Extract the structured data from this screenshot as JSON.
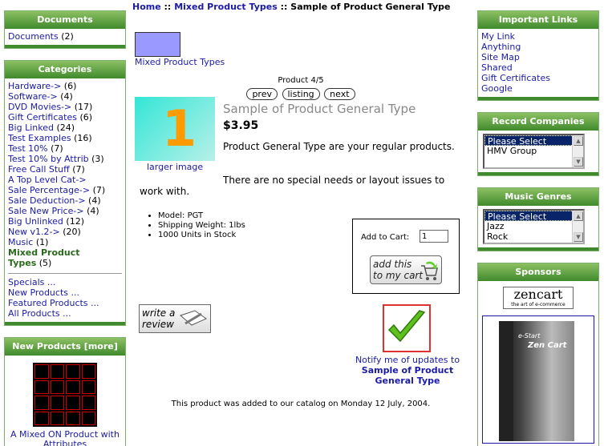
{
  "left": {
    "documents": {
      "title": "Documents",
      "item_label": "Documents",
      "item_count": "(2)"
    },
    "categories": {
      "title": "Categories",
      "items": [
        {
          "label": "Hardware->",
          "count": "(6)"
        },
        {
          "label": "Software->",
          "count": "(4)"
        },
        {
          "label": "DVD Movies->",
          "count": "(17)"
        },
        {
          "label": "Gift Certificates",
          "count": "(6)"
        },
        {
          "label": "Big Linked",
          "count": "(24)"
        },
        {
          "label": "Test Examples",
          "count": "(16)"
        },
        {
          "label": "Test 10%",
          "count": "(7)"
        },
        {
          "label": "Test 10% by Attrib",
          "count": "(3)"
        },
        {
          "label": "Free Call Stuff",
          "count": "(7)"
        },
        {
          "label": "A Top Level Cat->",
          "count": ""
        },
        {
          "label": "Sale Percentage->",
          "count": "(7)"
        },
        {
          "label": "Sale Deduction->",
          "count": "(4)"
        },
        {
          "label": "Sale New Price->",
          "count": "(4)"
        },
        {
          "label": "Big Unlinked",
          "count": "(12)"
        },
        {
          "label": "New v1.2->",
          "count": "(20)"
        },
        {
          "label": "Music",
          "count": "(1)"
        }
      ],
      "current_label_1": "Mixed Product",
      "current_label_2": "Types",
      "current_count": "(5)",
      "links": [
        "Specials ...",
        "New Products ...",
        "Featured Products ...",
        "All Products ..."
      ]
    },
    "new_products": {
      "title": "New Products  [more]",
      "product_name_1": "A Mixed ON Product with",
      "product_name_2": "Attributes"
    }
  },
  "main": {
    "breadcrumb": {
      "home": "Home",
      "sep": "::",
      "category": "Mixed Product Types",
      "current": "Sample of Product General Type"
    },
    "category_name": "Mixed Product Types",
    "product_number": "Product 4/5",
    "nav": {
      "prev": "prev",
      "listing": "listing",
      "next": "next"
    },
    "product_image_digit": "1",
    "larger_image": "larger image",
    "title": "Sample of Product General Type",
    "price": "$3.95",
    "desc_1": "Product General Type are your regular products.",
    "desc_2": "There are no special needs or layout issues to work with.",
    "attributes": [
      "Model: PGT",
      "Shipping Weight: 1lbs",
      "1000 Units in Stock"
    ],
    "cart": {
      "label": "Add to Cart:",
      "qty": "1",
      "button_line1": "add this",
      "button_line2": "to my cart"
    },
    "review": {
      "line1": "write a",
      "line2": "review"
    },
    "notify": {
      "text": "Notify me of updates to",
      "product_1": "Sample of Product",
      "product_2": "General Type"
    },
    "added": "This product was added to our catalog on Monday 12 July, 2004."
  },
  "right": {
    "important_links": {
      "title": "Important Links",
      "items": [
        "My Link",
        "Anything",
        "Site Map",
        "Shared",
        "Gift Certificates",
        "Google"
      ]
    },
    "record_companies": {
      "title": "Record Companies",
      "options": [
        "Please Select",
        "HMV Group"
      ]
    },
    "music_genres": {
      "title": "Music Genres",
      "options": [
        "Please Select",
        "Jazz",
        "Rock"
      ]
    },
    "sponsors": {
      "title": "Sponsors",
      "logo": "zencart",
      "logo_sub": "the art of e-commerce",
      "box_line1": "e-Start",
      "box_line2": "Zen Cart"
    }
  },
  "colors": {
    "header_green": "#3f8a2c",
    "link_blue": "#1a1aa6",
    "select_blue": "#0a246a"
  }
}
